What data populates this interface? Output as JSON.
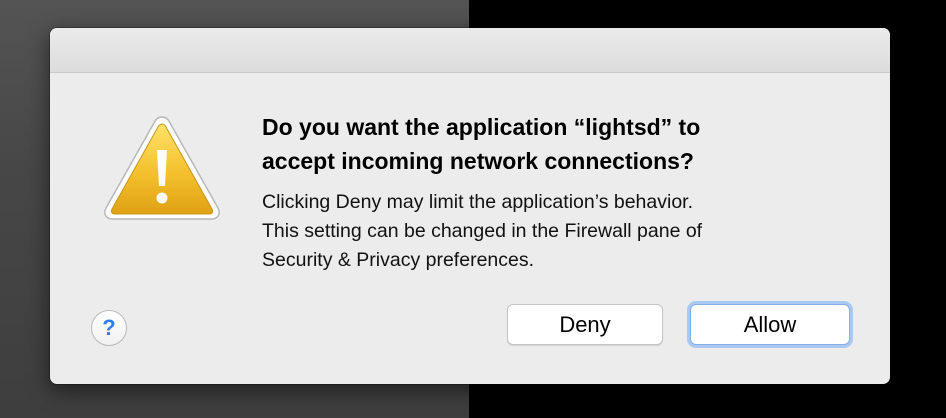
{
  "dialog": {
    "title_lines": [
      "Do you want the application “lightsd” to",
      "accept incoming network connections?"
    ],
    "message_lines": [
      "Clicking Deny may limit the application’s behavior.",
      "This setting can be changed in the Firewall pane of",
      "Security & Privacy preferences."
    ],
    "icon": "warning-icon",
    "help_label": "?",
    "buttons": {
      "deny_label": "Deny",
      "allow_label": "Allow",
      "default": "allow"
    }
  },
  "colors": {
    "dialog_bg": "#ececec",
    "warning_yellow": "#f2c029",
    "help_blue": "#2e7cf6",
    "focus_ring": "#a9c9f2"
  }
}
